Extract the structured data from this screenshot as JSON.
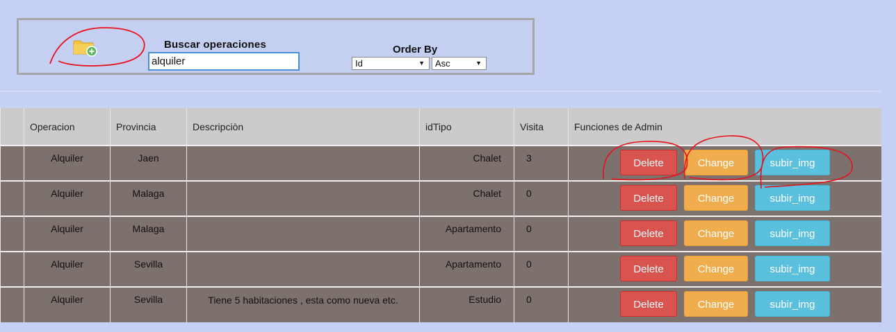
{
  "search": {
    "title": "Buscar operaciones",
    "value": "alquiler",
    "add_icon": "folder-add-icon"
  },
  "order": {
    "title": "Order By",
    "field_selected": "Id",
    "direction_selected": "Asc"
  },
  "table": {
    "headers": [
      "Operacion",
      "Provincia",
      "Descripciòn",
      "idTipo",
      "Visita",
      "Funciones de Admin"
    ],
    "rows": [
      {
        "operacion": "Alquiler",
        "provincia": "Jaen",
        "descripcion": "",
        "tipo": "Chalet",
        "visita": "3"
      },
      {
        "operacion": "Alquiler",
        "provincia": "Malaga",
        "descripcion": "",
        "tipo": "Chalet",
        "visita": "0"
      },
      {
        "operacion": "Alquiler",
        "provincia": "Malaga",
        "descripcion": "",
        "tipo": "Apartamento",
        "visita": "0"
      },
      {
        "operacion": "Alquiler",
        "provincia": "Sevilla",
        "descripcion": "",
        "tipo": "Apartamento",
        "visita": "0"
      },
      {
        "operacion": "Alquiler",
        "provincia": "Sevilla",
        "descripcion": "Tiene 5 habitaciones , esta como nueva etc.",
        "tipo": "Estudio",
        "visita": "0"
      }
    ],
    "actions": {
      "delete": "Delete",
      "change": "Change",
      "upload": "subir_img"
    }
  },
  "colors": {
    "background": "#c5d0f4",
    "row_bg": "#7d716e",
    "header_bg": "#cbcbcb",
    "delete": "#d9534f",
    "change": "#f0ad4e",
    "upload": "#5bc0de",
    "annotation": "#e8101a"
  }
}
